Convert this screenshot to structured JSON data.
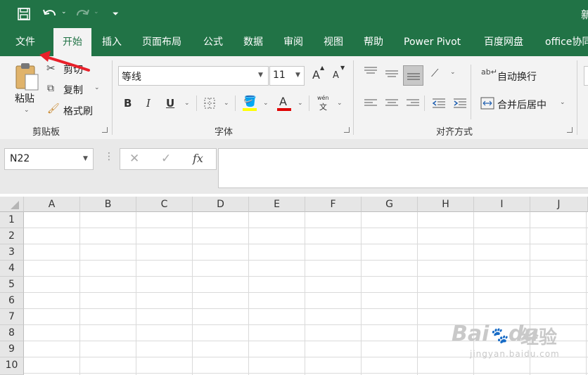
{
  "titlebar": {
    "right_fragment": "新"
  },
  "tabs": [
    {
      "label": "文件",
      "active": false
    },
    {
      "label": "开始",
      "active": true
    },
    {
      "label": "插入",
      "active": false
    },
    {
      "label": "页面布局",
      "active": false
    },
    {
      "label": "公式",
      "active": false
    },
    {
      "label": "数据",
      "active": false
    },
    {
      "label": "审阅",
      "active": false
    },
    {
      "label": "视图",
      "active": false
    },
    {
      "label": "帮助",
      "active": false
    },
    {
      "label": "Power Pivot",
      "active": false
    },
    {
      "label": "百度网盘",
      "active": false
    },
    {
      "label": "office协同",
      "active": false
    }
  ],
  "clipboard": {
    "paste": "粘贴",
    "cut": "剪切",
    "copy": "复制",
    "format_painter": "格式刷",
    "group": "剪贴板"
  },
  "font": {
    "name": "等线",
    "size": "11",
    "bold": "B",
    "italic": "I",
    "underline": "U",
    "grow": "A",
    "shrink": "A",
    "font_color": "A",
    "fill_color_accent": "#ffff00",
    "font_color_accent": "#e00000",
    "wen_top": "wén",
    "wen_bottom": "文",
    "group": "字体"
  },
  "alignment": {
    "wrap_text": "自动换行",
    "merge_center": "合并后居中",
    "group": "对齐方式"
  },
  "formula_bar": {
    "name_box": "N22",
    "fx": "fx",
    "content": ""
  },
  "sheet": {
    "columns": [
      "A",
      "B",
      "C",
      "D",
      "E",
      "F",
      "G",
      "H",
      "I",
      "J"
    ],
    "rows": [
      "1",
      "2",
      "3",
      "4",
      "5",
      "6",
      "7",
      "8",
      "9",
      "10"
    ]
  },
  "watermark": {
    "brand": "Bai",
    "brand2": "du",
    "chinese": "经验",
    "url": "jingyan.baidu.com"
  },
  "colors": {
    "excel_green": "#217346",
    "annotation_arrow": "#e8202a"
  }
}
